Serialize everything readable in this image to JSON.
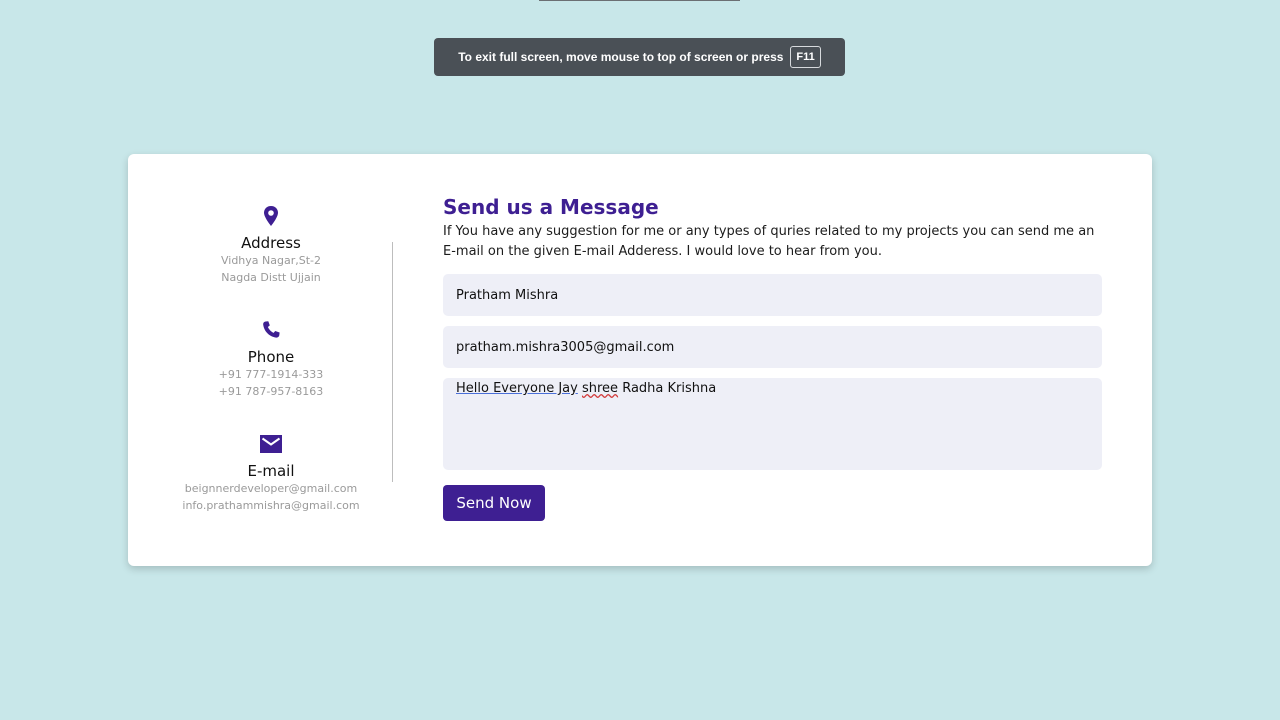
{
  "fullscreen_toast": {
    "message": "To exit full screen, move mouse to top of screen or press",
    "key": "F11"
  },
  "contact_info": {
    "address": {
      "icon": "location-pin-icon",
      "title": "Address",
      "lines": [
        "Vidhya Nagar,St-2",
        "Nagda Distt Ujjain"
      ]
    },
    "phone": {
      "icon": "phone-icon",
      "title": "Phone",
      "lines": [
        "+91 777-1914-333",
        "+91 787-957-8163"
      ]
    },
    "email": {
      "icon": "envelope-icon",
      "title": "E-mail",
      "lines": [
        "beignnerdeveloper@gmail.com",
        "info.prathammishra@gmail.com"
      ]
    }
  },
  "form": {
    "title": "Send us a Message",
    "description": "If You have any suggestion for me or any types of quries related to my projects you can send me an E-mail on the given E-mail Adderess. I would love to hear from you.",
    "name_value": "Pratham Mishra",
    "email_value": "pratham.mishra3005@gmail.com",
    "message_parts": {
      "part1": "Hello Everyone Jay",
      "part2": "shree",
      "part3": "Radha Krishna"
    },
    "submit_label": "Send Now"
  },
  "colors": {
    "accent": "#3e1f92",
    "page_background": "#c8e7e9",
    "field_background": "#eeeff7"
  }
}
